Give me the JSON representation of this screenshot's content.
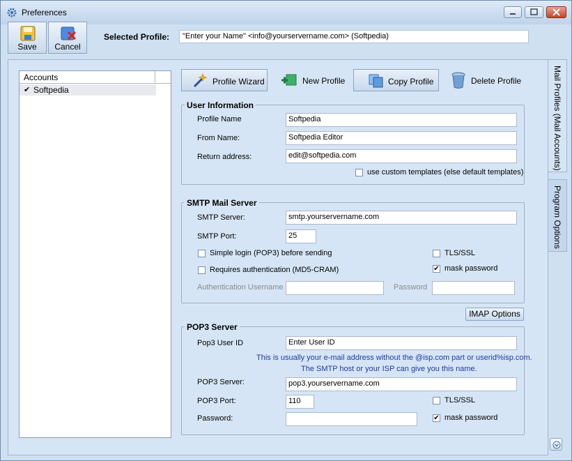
{
  "window": {
    "title": "Preferences"
  },
  "toolbar": {
    "save_label": "Save",
    "cancel_label": "Cancel"
  },
  "selected_profile": {
    "label": "Selected Profile:",
    "value": "\"Enter your Name\" <info@yourservername.com> (Softpedia)"
  },
  "accounts": {
    "header": "Accounts",
    "items": [
      {
        "name": "Softpedia",
        "checked": "✔"
      }
    ]
  },
  "actions": {
    "profile_wizard": "Profile Wizard",
    "new_profile": "New Profile",
    "copy_profile": "Copy Profile",
    "delete_profile": "Delete Profile"
  },
  "user_info": {
    "title": "User Information",
    "profile_name_label": "Profile Name",
    "profile_name_value": "Softpedia",
    "from_name_label": "From Name:",
    "from_name_value": "Softpedia Editor",
    "return_address_label": "Return address:",
    "return_address_value": "edit@softpedia.com",
    "custom_templates_label": "use custom templates (else default templates)"
  },
  "smtp": {
    "title": "SMTP Mail Server",
    "server_label": "SMTP Server:",
    "server_value": "smtp.yourservername.com",
    "port_label": "SMTP Port:",
    "port_value": "25",
    "simple_login_label": "Simple login (POP3) before sending",
    "requires_auth_label": "Requires authentication (MD5-CRAM)",
    "tls_label": "TLS/SSL",
    "mask_password_label": "mask password",
    "mask_password_checked": "✔",
    "auth_username_label": "Authentication Username",
    "password_label": "Password"
  },
  "imap_button": "IMAP Options",
  "pop3": {
    "title": "POP3 Server",
    "user_id_label": "Pop3 User ID",
    "user_id_value": "Enter User ID",
    "info_line1": "This is usually your e-mail address without the @isp.com part or userid%isp.com.",
    "info_line2": "The SMTP host or your ISP can give you this name.",
    "server_label": "POP3 Server:",
    "server_value": "pop3.yourservername.com",
    "port_label": "POP3 Port:",
    "port_value": "110",
    "password_label": "Password:",
    "tls_label": "TLS/SSL",
    "mask_password_label": "mask password",
    "mask_password_checked": "✔"
  },
  "side_tabs": {
    "mail_profiles": "Mail Profiles (Mail Accounts)",
    "program_options": "Program Options"
  },
  "icons": {
    "app": "gear-icon",
    "save": "floppy-save-icon",
    "cancel": "cancel-x-icon",
    "wizard": "wand-icon",
    "new": "new-profile-icon",
    "copy": "copy-profile-icon",
    "delete": "trash-icon",
    "scroll": "chevron-down-icon"
  }
}
